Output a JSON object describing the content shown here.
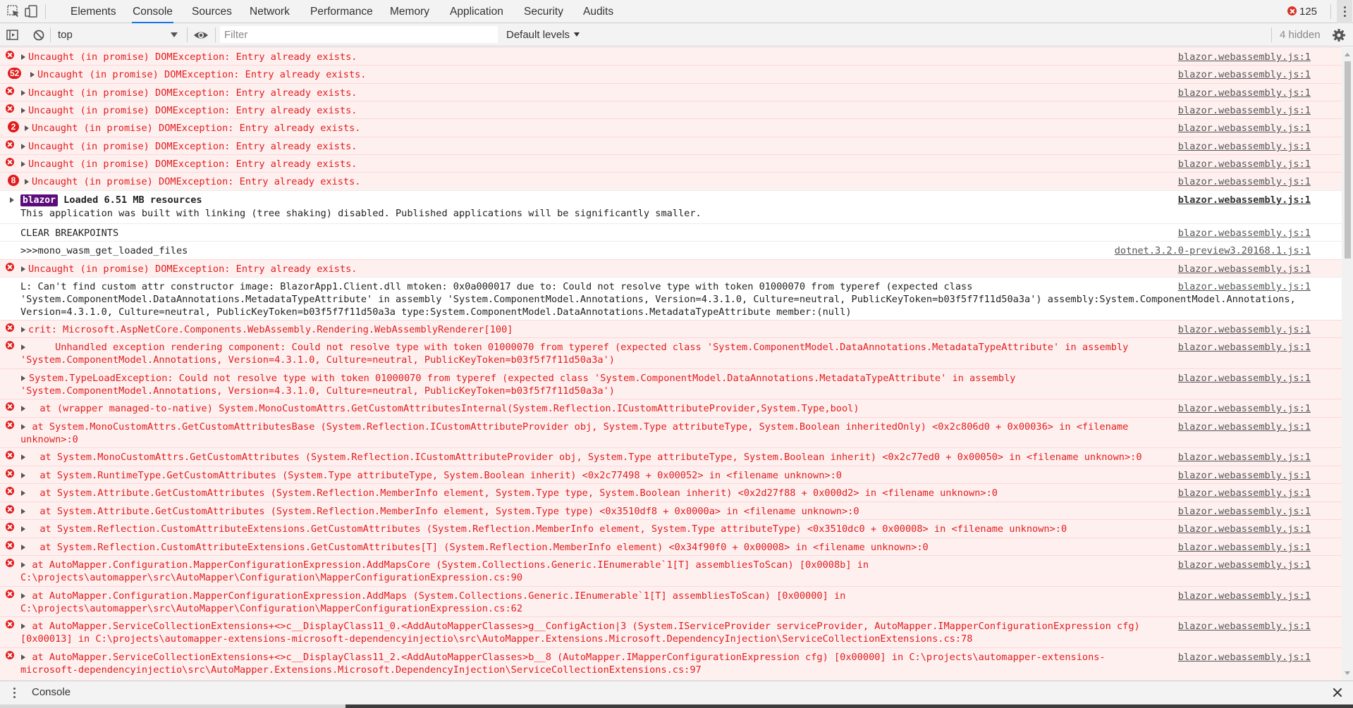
{
  "tabs": {
    "elements": "Elements",
    "console": "Console",
    "sources": "Sources",
    "network": "Network",
    "performance": "Performance",
    "memory": "Memory",
    "application": "Application",
    "security": "Security",
    "audits": "Audits"
  },
  "error_count": "125",
  "toolbar": {
    "context": "top",
    "filter_placeholder": "Filter",
    "levels": "Default levels",
    "hidden": "4 hidden"
  },
  "messages": {
    "m1": {
      "text": "Uncaught (in promise) DOMException: Entry already exists.",
      "src": "blazor.webassembly.js:1"
    },
    "m2": {
      "count": "52",
      "text": "Uncaught (in promise) DOMException: Entry already exists.",
      "src": "blazor.webassembly.js:1"
    },
    "m3": {
      "text": "Uncaught (in promise) DOMException: Entry already exists.",
      "src": "blazor.webassembly.js:1"
    },
    "m4": {
      "text": "Uncaught (in promise) DOMException: Entry already exists.",
      "src": "blazor.webassembly.js:1"
    },
    "m5": {
      "count": "2",
      "text": "Uncaught (in promise) DOMException: Entry already exists.",
      "src": "blazor.webassembly.js:1"
    },
    "m6": {
      "text": "Uncaught (in promise) DOMException: Entry already exists.",
      "src": "blazor.webassembly.js:1"
    },
    "m7": {
      "text": "Uncaught (in promise) DOMException: Entry already exists.",
      "src": "blazor.webassembly.js:1"
    },
    "m8": {
      "count": "8",
      "text": "Uncaught (in promise) DOMException: Entry already exists.",
      "src": "blazor.webassembly.js:1"
    },
    "m9": {
      "badge": "blazor",
      "line1": "Loaded 6.51 MB resources",
      "line2": "This application was built with linking (tree shaking) disabled. Published applications will be significantly smaller.",
      "src": "blazor.webassembly.js:1"
    },
    "m10": {
      "text": "CLEAR BREAKPOINTS",
      "src": "blazor.webassembly.js:1"
    },
    "m11": {
      "text": ">>>mono_wasm_get_loaded_files",
      "src": "dotnet.3.2.0-preview3.20168.1.js:1"
    },
    "m12": {
      "text": "Uncaught (in promise) DOMException: Entry already exists.",
      "src": "blazor.webassembly.js:1"
    },
    "m13": {
      "text": "L: Can't find custom attr constructor image: BlazorApp1.Client.dll mtoken: 0x0a000017 due to: Could not resolve type with token 01000070 from typeref (expected class\n'System.ComponentModel.DataAnnotations.MetadataTypeAttribute' in assembly 'System.ComponentModel.Annotations, Version=4.3.1.0, Culture=neutral, PublicKeyToken=b03f5f7f11d50a3a') assembly:System.ComponentModel.Annotations,\nVersion=4.3.1.0, Culture=neutral, PublicKeyToken=b03f5f7f11d50a3a type:System.ComponentModel.DataAnnotations.MetadataTypeAttribute member:(null)",
      "src": "blazor.webassembly.js:1"
    },
    "m14": {
      "text": "crit: Microsoft.AspNetCore.Components.WebAssembly.Rendering.WebAssemblyRenderer[100]",
      "src": "blazor.webassembly.js:1"
    },
    "m15": {
      "text": "      Unhandled exception rendering component: Could not resolve type with token 01000070 from typeref (expected class 'System.ComponentModel.DataAnnotations.MetadataTypeAttribute' in assembly\n'System.ComponentModel.Annotations, Version=4.3.1.0, Culture=neutral, PublicKeyToken=b03f5f7f11d50a3a')",
      "src": "blazor.webassembly.js:1"
    },
    "m16": {
      "text": "System.TypeLoadException: Could not resolve type with token 01000070 from typeref (expected class 'System.ComponentModel.DataAnnotations.MetadataTypeAttribute' in assembly\n'System.ComponentModel.Annotations, Version=4.3.1.0, Culture=neutral, PublicKeyToken=b03f5f7f11d50a3a')",
      "src": "blazor.webassembly.js:1"
    },
    "m17": {
      "text": "  at (wrapper managed-to-native) System.MonoCustomAttrs.GetCustomAttributesInternal(System.Reflection.ICustomAttributeProvider,System.Type,bool)",
      "src": "blazor.webassembly.js:1"
    },
    "m18": {
      "text": "  at System.MonoCustomAttrs.GetCustomAttributesBase (System.Reflection.ICustomAttributeProvider obj, System.Type attributeType, System.Boolean inheritedOnly) <0x2c806d0 + 0x00036> in <filename\nunknown>:0",
      "src": "blazor.webassembly.js:1"
    },
    "m19": {
      "text": "  at System.MonoCustomAttrs.GetCustomAttributes (System.Reflection.ICustomAttributeProvider obj, System.Type attributeType, System.Boolean inherit) <0x2c77ed0 + 0x00050> in <filename unknown>:0",
      "src": "blazor.webassembly.js:1"
    },
    "m20": {
      "text": "  at System.RuntimeType.GetCustomAttributes (System.Type attributeType, System.Boolean inherit) <0x2c77498 + 0x00052> in <filename unknown>:0",
      "src": "blazor.webassembly.js:1"
    },
    "m21": {
      "text": "  at System.Attribute.GetCustomAttributes (System.Reflection.MemberInfo element, System.Type type, System.Boolean inherit) <0x2d27f88 + 0x000d2> in <filename unknown>:0",
      "src": "blazor.webassembly.js:1"
    },
    "m22": {
      "text": "  at System.Attribute.GetCustomAttributes (System.Reflection.MemberInfo element, System.Type type) <0x3510df8 + 0x0000a> in <filename unknown>:0",
      "src": "blazor.webassembly.js:1"
    },
    "m23": {
      "text": "  at System.Reflection.CustomAttributeExtensions.GetCustomAttributes (System.Reflection.MemberInfo element, System.Type attributeType) <0x3510dc0 + 0x00008> in <filename unknown>:0",
      "src": "blazor.webassembly.js:1"
    },
    "m24": {
      "text": "  at System.Reflection.CustomAttributeExtensions.GetCustomAttributes[T] (System.Reflection.MemberInfo element) <0x34f90f0 + 0x00008> in <filename unknown>:0",
      "src": "blazor.webassembly.js:1"
    },
    "m25": {
      "text": "  at AutoMapper.Configuration.MapperConfigurationExpression.AddMapsCore (System.Collections.Generic.IEnumerable`1[T] assembliesToScan) [0x0008b] in\nC:\\projects\\automapper\\src\\AutoMapper\\Configuration\\MapperConfigurationExpression.cs:90",
      "src": "blazor.webassembly.js:1"
    },
    "m26": {
      "text": "  at AutoMapper.Configuration.MapperConfigurationExpression.AddMaps (System.Collections.Generic.IEnumerable`1[T] assembliesToScan) [0x00000] in\nC:\\projects\\automapper\\src\\AutoMapper\\Configuration\\MapperConfigurationExpression.cs:62",
      "src": "blazor.webassembly.js:1"
    },
    "m27": {
      "text": "  at AutoMapper.ServiceCollectionExtensions+<>c__DisplayClass11_0.<AddAutoMapperClasses>g__ConfigAction|3 (System.IServiceProvider serviceProvider, AutoMapper.IMapperConfigurationExpression cfg)\n[0x00013] in C:\\projects\\automapper-extensions-microsoft-dependencyinjectio\\src\\AutoMapper.Extensions.Microsoft.DependencyInjection\\ServiceCollectionExtensions.cs:78",
      "src": "blazor.webassembly.js:1"
    },
    "m28": {
      "text": "  at AutoMapper.ServiceCollectionExtensions+<>c__DisplayClass11_2.<AddAutoMapperClasses>b__8 (AutoMapper.IMapperConfigurationExpression cfg) [0x00000] in C:\\projects\\automapper-extensions-\nmicrosoft-dependencyinjectio\\src\\AutoMapper.Extensions.Microsoft.DependencyInjection\\ServiceCollectionExtensions.cs:97",
      "src": "blazor.webassembly.js:1"
    }
  },
  "drawer": {
    "title": "Console"
  }
}
